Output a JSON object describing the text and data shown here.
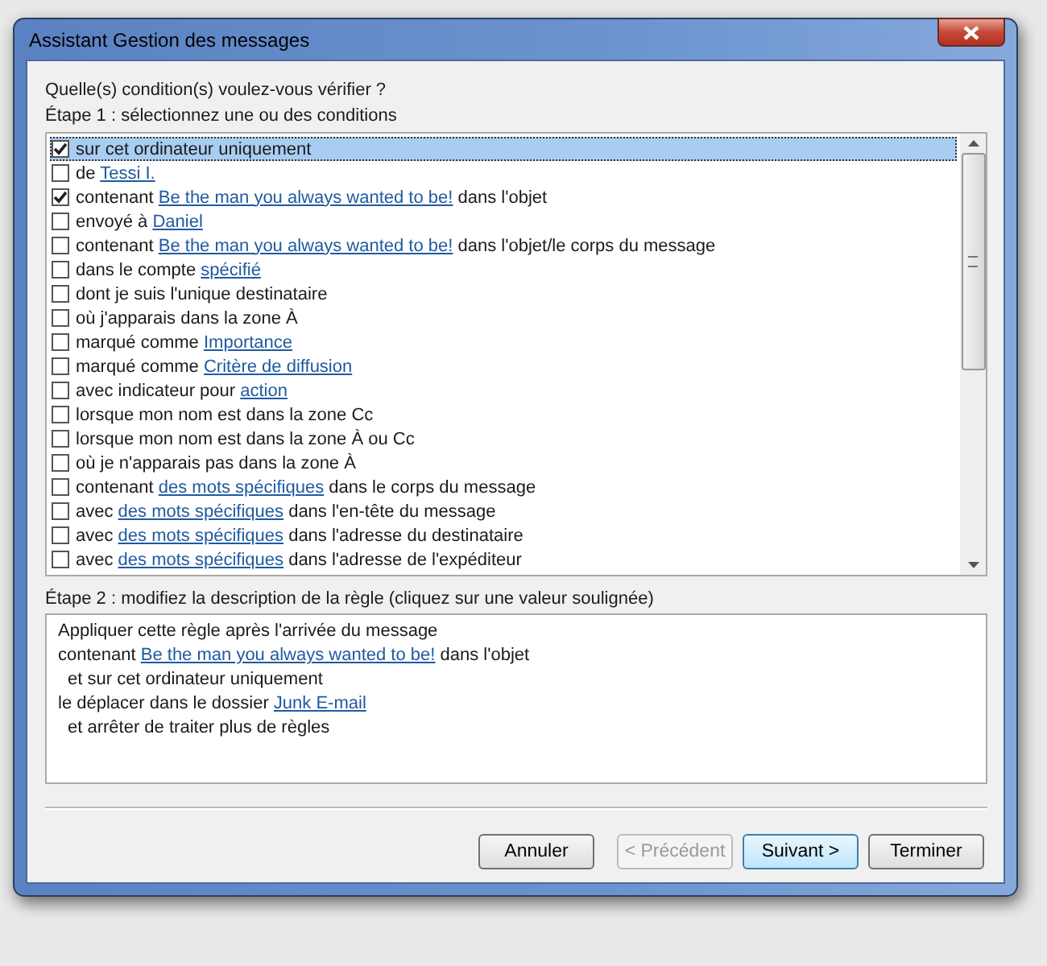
{
  "window": {
    "title": "Assistant Gestion des messages"
  },
  "question": "Quelle(s) condition(s) voulez-vous vérifier ?",
  "step1": {
    "label": "Étape 1 : sélectionnez une ou des conditions",
    "conditions": [
      {
        "before": "sur cet ordinateur uniquement",
        "checked": true,
        "selected": true
      },
      {
        "before": "de ",
        "link": "Tessi I.",
        "checked": false,
        "selected": false
      },
      {
        "before": "contenant ",
        "link": "Be the man you always wanted to be!",
        "after": " dans l'objet",
        "checked": true,
        "selected": false
      },
      {
        "before": "envoyé à ",
        "link": "Daniel",
        "checked": false,
        "selected": false
      },
      {
        "before": "contenant ",
        "link": "Be the man you always wanted to be!",
        "after": " dans l'objet/le corps du message",
        "checked": false,
        "selected": false
      },
      {
        "before": "dans le compte ",
        "link": "spécifié",
        "checked": false,
        "selected": false
      },
      {
        "before": "dont je suis l'unique destinataire",
        "checked": false,
        "selected": false
      },
      {
        "before": "où j'apparais dans la zone À",
        "checked": false,
        "selected": false
      },
      {
        "before": "marqué comme ",
        "link": "Importance",
        "checked": false,
        "selected": false
      },
      {
        "before": "marqué comme ",
        "link": "Critère de diffusion",
        "checked": false,
        "selected": false
      },
      {
        "before": "avec indicateur pour ",
        "link": "action",
        "checked": false,
        "selected": false
      },
      {
        "before": "lorsque mon nom est dans la zone Cc",
        "checked": false,
        "selected": false
      },
      {
        "before": "lorsque mon nom est dans la zone À ou Cc",
        "checked": false,
        "selected": false
      },
      {
        "before": "où je n'apparais pas dans la zone À",
        "checked": false,
        "selected": false
      },
      {
        "before": "contenant ",
        "link": "des mots spécifiques",
        "after": " dans le corps du message",
        "checked": false,
        "selected": false
      },
      {
        "before": "avec ",
        "link": "des mots spécifiques",
        "after": " dans l'en-tête du message",
        "checked": false,
        "selected": false
      },
      {
        "before": "avec ",
        "link": "des mots spécifiques",
        "after": " dans l'adresse du destinataire",
        "checked": false,
        "selected": false
      },
      {
        "before": "avec ",
        "link": "des mots spécifiques",
        "after": " dans l'adresse de l'expéditeur",
        "checked": false,
        "selected": false
      }
    ]
  },
  "step2": {
    "label": "Étape 2 : modifiez la description de la règle (cliquez sur une valeur soulignée)",
    "lines": [
      {
        "kind": "main",
        "before": "Appliquer cette règle après l'arrivée du message"
      },
      {
        "kind": "main",
        "before": "contenant ",
        "link": "Be the man you always wanted to be!",
        "after": " dans l'objet"
      },
      {
        "kind": "sub",
        "before": "et sur cet ordinateur uniquement"
      },
      {
        "kind": "main",
        "before": "le déplacer dans le dossier ",
        "link": "Junk E-mail"
      },
      {
        "kind": "sub",
        "before": "et arrêter de traiter plus de règles"
      }
    ]
  },
  "buttons": [
    {
      "label": "Annuler",
      "disabled": false,
      "default": false
    },
    {
      "label": "< Précédent",
      "disabled": true,
      "default": false
    },
    {
      "label": "Suivant >",
      "disabled": false,
      "default": true
    },
    {
      "label": "Terminer",
      "disabled": false,
      "default": false
    }
  ]
}
